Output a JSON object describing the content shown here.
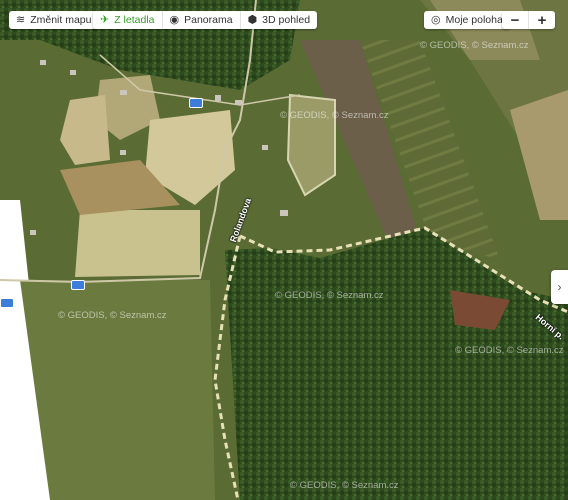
{
  "toolbar": {
    "change_map": "Změnit mapu",
    "aerial": "Z letadla",
    "panorama": "Panorama",
    "view_3d": "3D pohled"
  },
  "location": {
    "my_location": "Moje poloha"
  },
  "zoom": {
    "minus": "−",
    "plus": "+"
  },
  "map_labels": {
    "road_1": "Rolandova",
    "road_2": "Horní p."
  },
  "watermark": "© GEODIS, © Seznam.cz",
  "side_toggle": "›",
  "colors": {
    "active": "#3a9a2b",
    "forest": "#2f4a1f",
    "meadow": "#7a8a45"
  }
}
